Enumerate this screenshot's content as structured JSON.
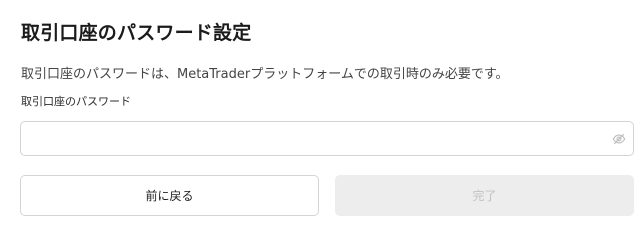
{
  "header": {
    "title": "取引口座のパスワード設定"
  },
  "description": "取引口座のパスワードは、MetaTraderプラットフォームでの取引時のみ必要です。",
  "password_field": {
    "label": "取引口座のパスワード",
    "value": "",
    "placeholder": "",
    "visibility_icon": "eye-slash-icon"
  },
  "actions": {
    "back_label": "前に戻る",
    "done_label": "完了",
    "done_disabled": true
  },
  "colors": {
    "border": "#d4d4d4",
    "disabled_bg": "#ededed",
    "disabled_text": "#c2c2c2"
  }
}
